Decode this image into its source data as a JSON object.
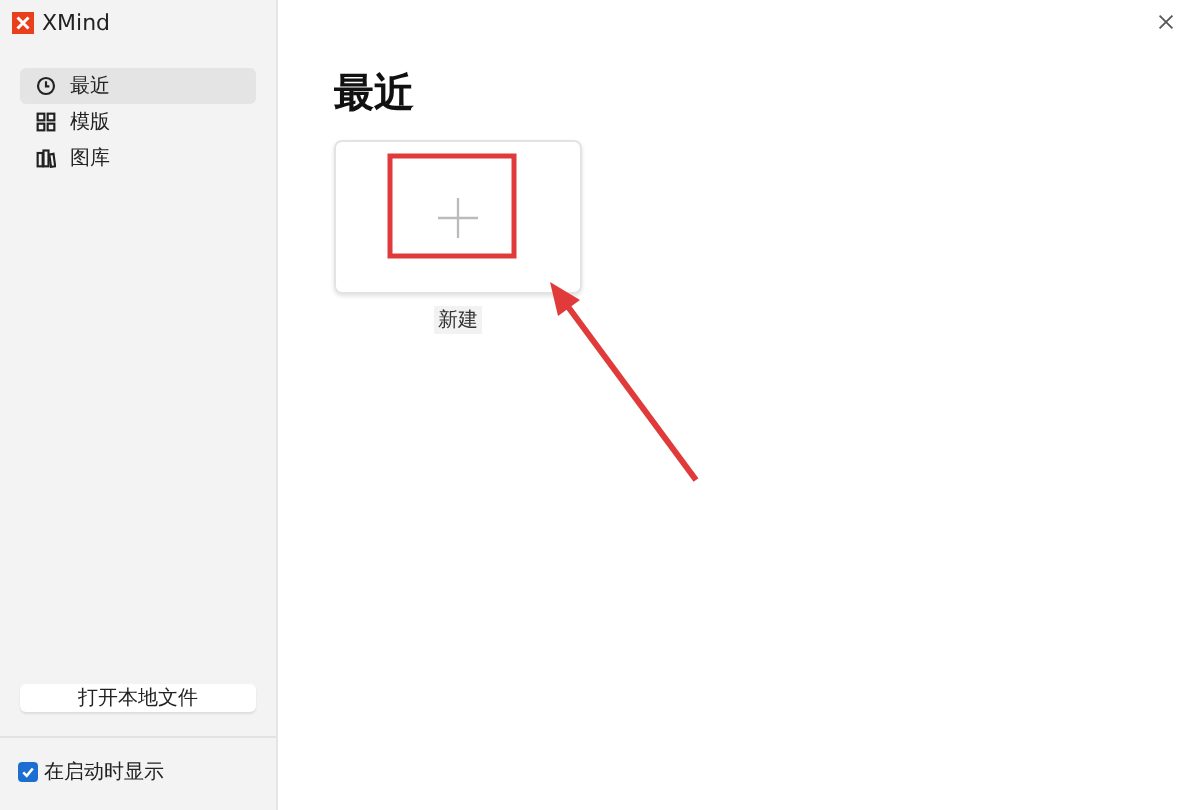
{
  "window": {
    "title": "XMind"
  },
  "sidebar": {
    "items": [
      {
        "label": "最近",
        "selected": true
      },
      {
        "label": "模版",
        "selected": false
      },
      {
        "label": "图库",
        "selected": false
      }
    ],
    "open_local_button": "打开本地文件",
    "show_on_startup": {
      "label": "在启动时显示",
      "checked": true
    }
  },
  "main": {
    "heading": "最近",
    "new_item": {
      "label": "新建"
    }
  }
}
